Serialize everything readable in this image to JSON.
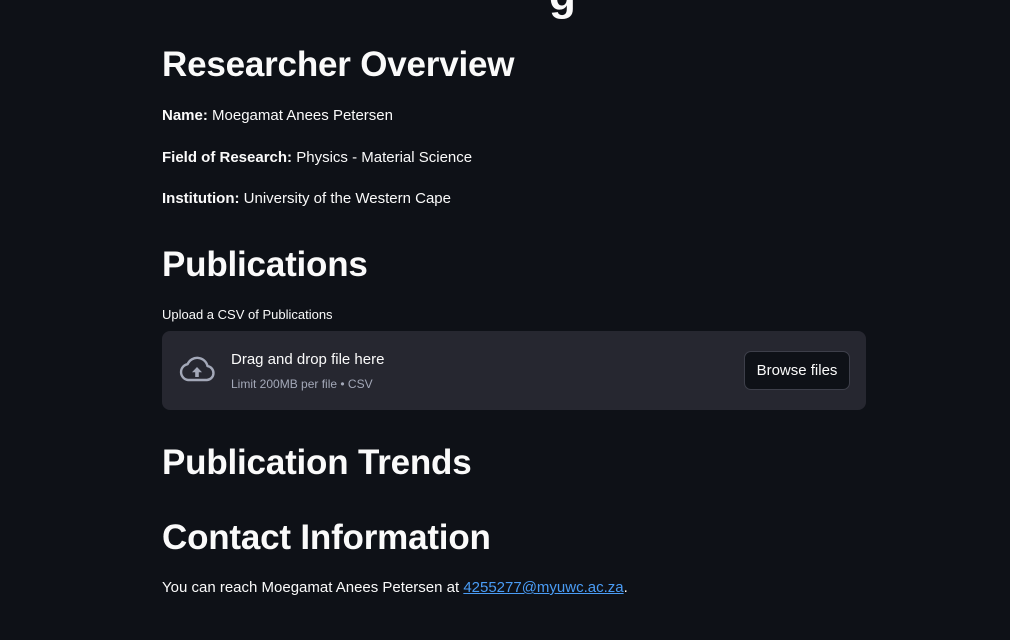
{
  "page": {
    "cut_title_fragment": "g"
  },
  "overview": {
    "heading": "Researcher Overview",
    "name_label": "Name:",
    "name_value": "Moegamat Anees Petersen",
    "field_label": "Field of Research:",
    "field_value": "Physics - Material Science",
    "institution_label": "Institution:",
    "institution_value": "University of the Western Cape"
  },
  "publications": {
    "heading": "Publications",
    "upload_label": "Upload a CSV of Publications",
    "dropzone_title": "Drag and drop file here",
    "dropzone_limit": "Limit 200MB per file • CSV",
    "browse_label": "Browse files",
    "icon": "cloud-upload-icon"
  },
  "trends": {
    "heading": "Publication Trends"
  },
  "contact": {
    "heading": "Contact Information",
    "prefix": "You can reach Moegamat Anees Petersen at ",
    "email": "4255277@myuwc.ac.za",
    "suffix": "."
  },
  "colors": {
    "background": "#0e1117",
    "dropzone": "#262730",
    "link": "#4a9cf5",
    "muted": "#a3a8b8"
  }
}
